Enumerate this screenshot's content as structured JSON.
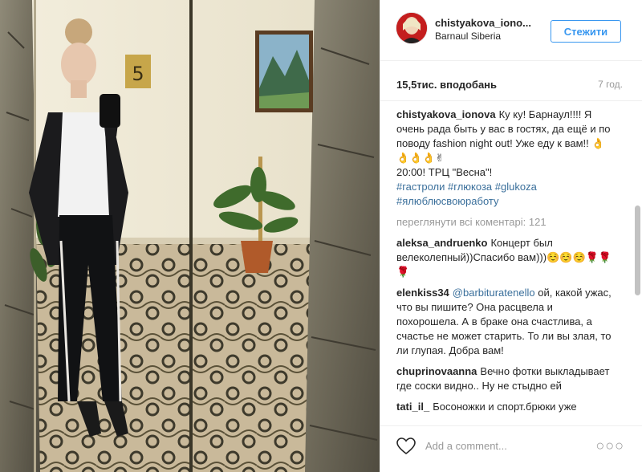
{
  "post": {
    "username": "chistyakova_iono...",
    "location": "Barnaul Siberia",
    "follow_label": "Стежити",
    "likes": "15,5тис. вподобань",
    "time": "7 год."
  },
  "caption": {
    "username": "chistyakova_ionova",
    "text_1": "Ку ку! Барнаул!!!! Я очень рада быть у вас в гостях, да ещё и по поводу fashion night out! Уже еду к вам!! ",
    "emoji_1": "👌👌👌👌✌",
    "text_2": "20:00! ТРЦ \"Весна\"!",
    "hashtag_1": "#гастроли",
    "hashtag_2": "#глюкоза",
    "hashtag_3": "#glukoza",
    "hashtag_4": "#ялюблюсвоюработу"
  },
  "view_all": "переглянути всі коментарі: 121",
  "comments": [
    {
      "username": "aleksa_andruenko",
      "text": "Концерт был велеколепный))Спасибо вам)))☺️☺️☺️🌹🌹🌹"
    },
    {
      "username": "elenkiss34",
      "mention": "@barbituratenello",
      "text": "ой, какой ужас, что вы пишите? Она расцвела и похорошела. А в браке она счастлива, а счастье не может старить. То ли вы злая, то ли глупая. Добра вам!"
    },
    {
      "username": "chuprinovaanna",
      "text": "Вечно фотки выкладывает где соски видно.. Ну не стыдно ей"
    },
    {
      "username": "tati_il_",
      "text": "Босоножки и спорт.брюки уже"
    }
  ],
  "footer": {
    "add_comment_placeholder": "Add a comment...",
    "more_glyph": "○○○"
  },
  "icons": {
    "heart": "heart-icon",
    "more": "more-options-icon"
  },
  "colors": {
    "accent": "#3897f0",
    "hashtag": "#3a6f9b",
    "muted": "#999999"
  },
  "photo": {
    "door_number": "5"
  }
}
